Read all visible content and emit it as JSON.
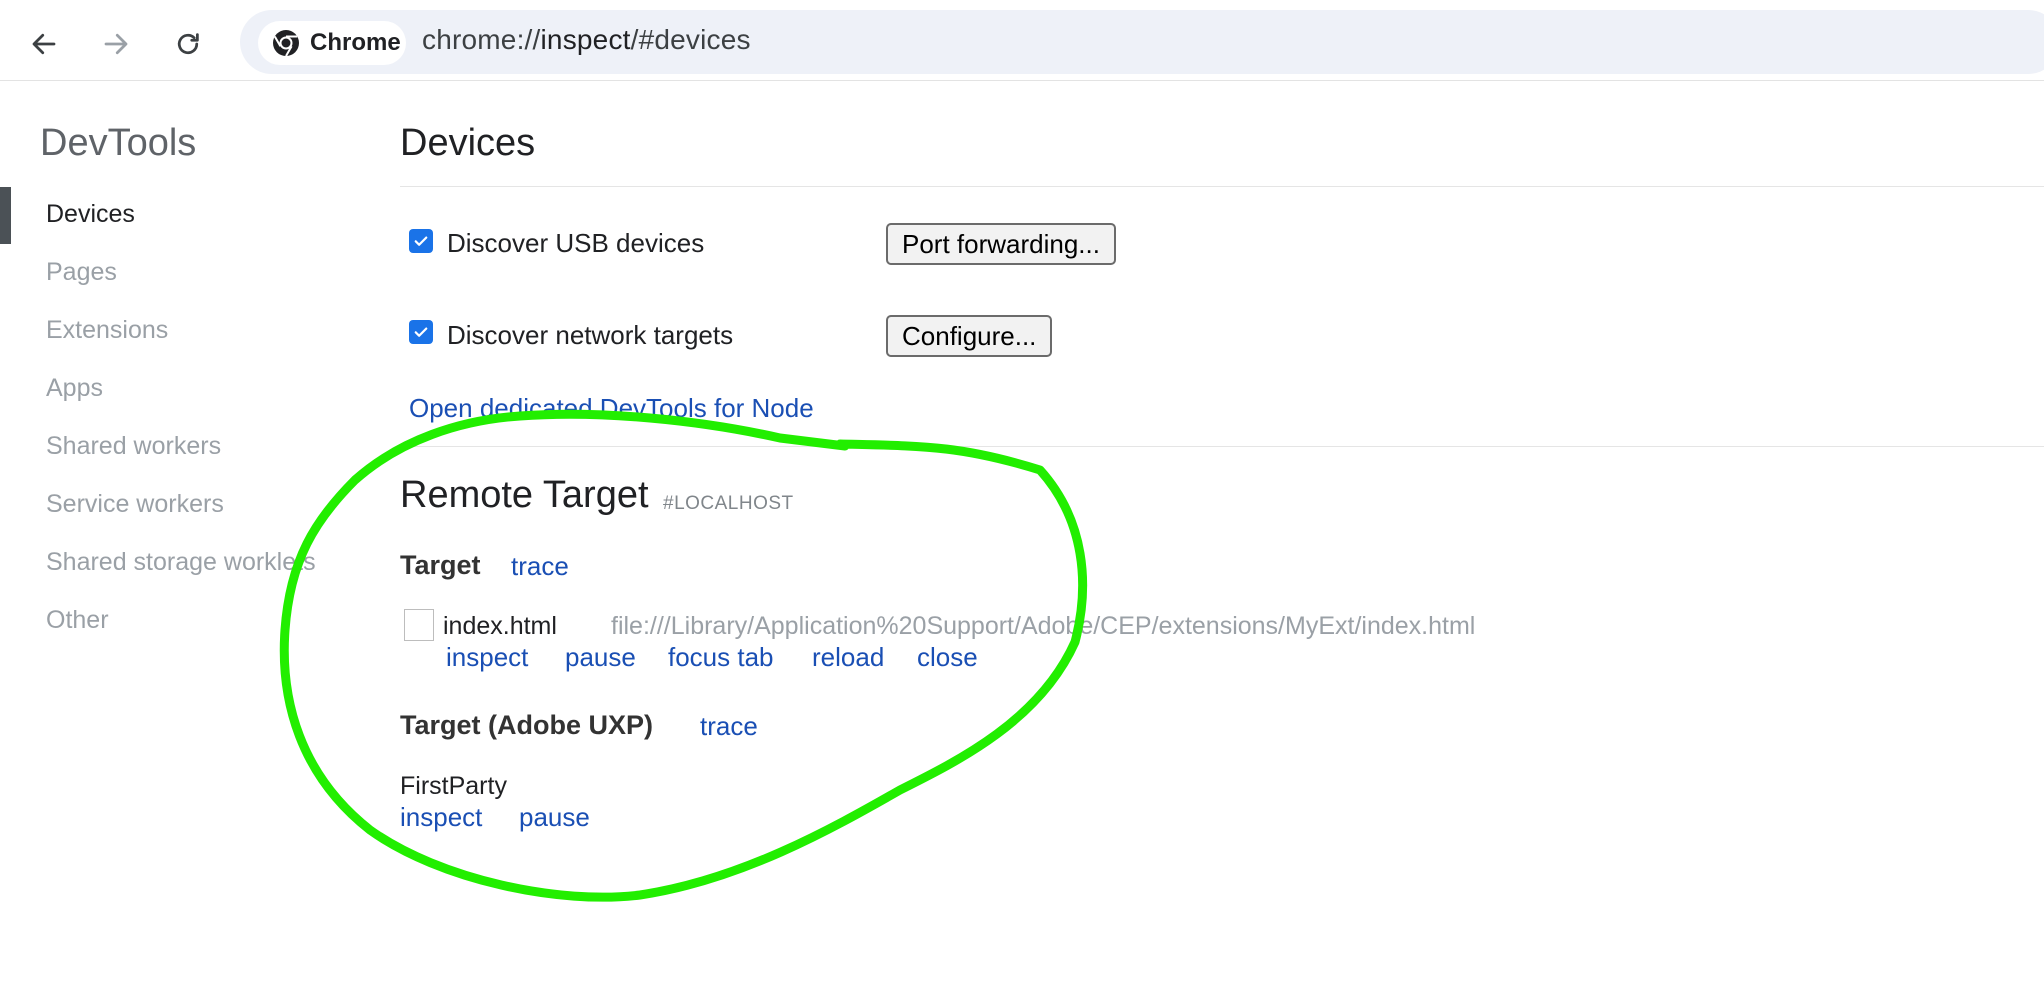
{
  "toolbar": {
    "chip_label": "Chrome",
    "url_scheme": "chrome://",
    "url_host": "inspect",
    "url_path": "/#devices"
  },
  "sidebar": {
    "title": "DevTools",
    "items": [
      {
        "label": "Devices",
        "active": true
      },
      {
        "label": "Pages"
      },
      {
        "label": "Extensions"
      },
      {
        "label": "Apps"
      },
      {
        "label": "Shared workers"
      },
      {
        "label": "Service workers"
      },
      {
        "label": "Shared storage worklets"
      },
      {
        "label": "Other"
      }
    ]
  },
  "main": {
    "title": "Devices",
    "discover_usb": {
      "label": "Discover USB devices",
      "checked": true
    },
    "port_forwarding_button": "Port forwarding...",
    "discover_network": {
      "label": "Discover network targets",
      "checked": true
    },
    "configure_button": "Configure...",
    "node_link": "Open dedicated DevTools for Node",
    "remote_target": {
      "title": "Remote Target",
      "tag": "#LOCALHOST",
      "groups": [
        {
          "heading": "Target",
          "trace_label": "trace",
          "item": {
            "name": "index.html",
            "url": "file:///Library/Application%20Support/Adobe/CEP/extensions/MyExt/index.html",
            "actions": [
              "inspect",
              "pause",
              "focus tab",
              "reload",
              "close"
            ]
          }
        },
        {
          "heading": "Target (Adobe UXP)",
          "trace_label": "trace",
          "item": {
            "name": "FirstParty",
            "actions": [
              "inspect",
              "pause"
            ]
          }
        }
      ]
    }
  },
  "colors": {
    "link": "#1a4fb4",
    "checkbox": "#1a73e8",
    "annotation": "#22ee00"
  }
}
